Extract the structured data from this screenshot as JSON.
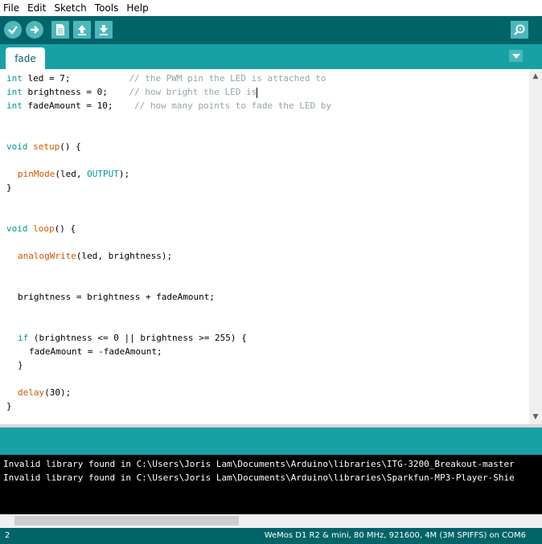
{
  "menu": [
    "File",
    "Edit",
    "Sketch",
    "Tools",
    "Help"
  ],
  "toolbar": {
    "icons": [
      "verify-icon",
      "upload-icon",
      "new-icon",
      "open-icon",
      "save-icon",
      "serial-monitor-icon"
    ]
  },
  "tabs": [
    {
      "label": "fade"
    }
  ],
  "code": {
    "line1": {
      "kw": "int",
      "rest": " led = 7;           ",
      "cm": "// the PWM pin the LED is attached to"
    },
    "line2": {
      "kw": "int",
      "rest": " brightness = 0;    ",
      "cm": "// how bright the LED is"
    },
    "line3": {
      "kw": "int",
      "rest": " fadeAmount = 10;    ",
      "cm": "// how many points to fade the LED by"
    },
    "line6": {
      "kw": "void",
      "sp": " ",
      "fn": "setup",
      "rest": "() {"
    },
    "line8": {
      "fn": "pinMode",
      "rest1": "(led, ",
      "const": "OUTPUT",
      "rest2": ");"
    },
    "line9": "}",
    "line12": {
      "kw": "void",
      "sp": " ",
      "fn": "loop",
      "rest": "() {"
    },
    "line14": {
      "fn": "analogWrite",
      "rest": "(led, brightness);"
    },
    "line17": "brightness = brightness + fadeAmount;",
    "line20": {
      "kw": "if",
      "rest": " (brightness <= 0 || brightness >= 255) {"
    },
    "line21": "fadeAmount = -fadeAmount;",
    "line22": "}",
    "line24": {
      "fn": "delay",
      "rest": "(30);"
    },
    "line25": "}"
  },
  "console": [
    "Invalid library found in C:\\Users\\Joris Lam\\Documents\\Arduino\\libraries\\ITG-3200_Breakout-master",
    "Invalid library found in C:\\Users\\Joris Lam\\Documents\\Arduino\\libraries\\Sparkfun-MP3-Player-Shie"
  ],
  "status": {
    "line_number": "2",
    "board": "WeMos D1 R2 & mini, 80 MHz, 921600, 4M (3M SPIFFS) on COM6"
  }
}
